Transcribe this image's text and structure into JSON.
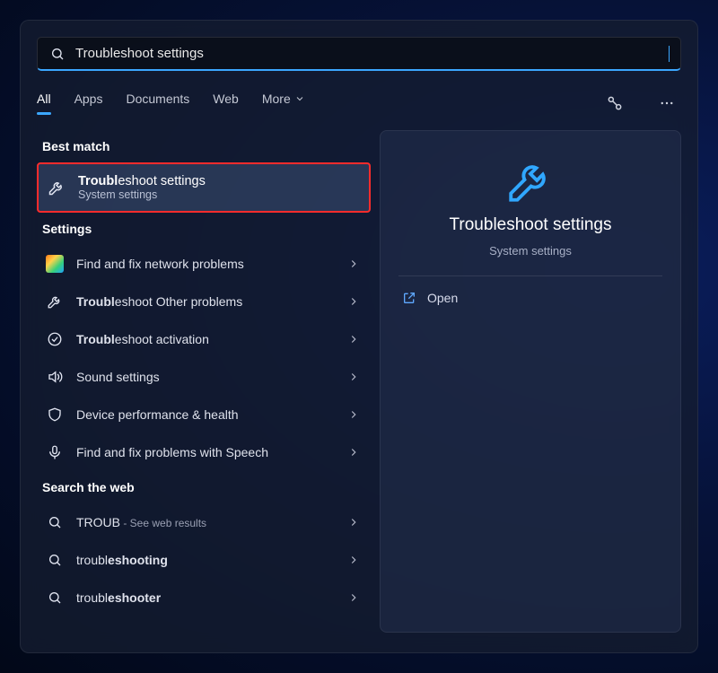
{
  "search": {
    "value": "Troubleshoot settings"
  },
  "tabs": {
    "all": "All",
    "apps": "Apps",
    "documents": "Documents",
    "web": "Web",
    "more": "More"
  },
  "sections": {
    "best_match": "Best match",
    "settings": "Settings",
    "search_web": "Search the web"
  },
  "best": {
    "title_bold": "Troubl",
    "title_rest": "eshoot settings",
    "subtitle": "System settings"
  },
  "settings_results": [
    {
      "label": "Find and fix network problems"
    },
    {
      "label_bold": "Troubl",
      "label_rest": "eshoot Other problems"
    },
    {
      "label_bold": "Troubl",
      "label_rest": "eshoot activation"
    },
    {
      "label": "Sound settings"
    },
    {
      "label": "Device performance & health"
    },
    {
      "label": "Find and fix problems with Speech"
    }
  ],
  "web_results": [
    {
      "main": "TROUB",
      "suffix": " - See web results"
    },
    {
      "pre": "troubl",
      "bold": "eshooting"
    },
    {
      "pre": "troubl",
      "bold": "eshooter"
    }
  ],
  "preview": {
    "title": "Troubleshoot settings",
    "subtitle": "System settings",
    "open": "Open"
  }
}
